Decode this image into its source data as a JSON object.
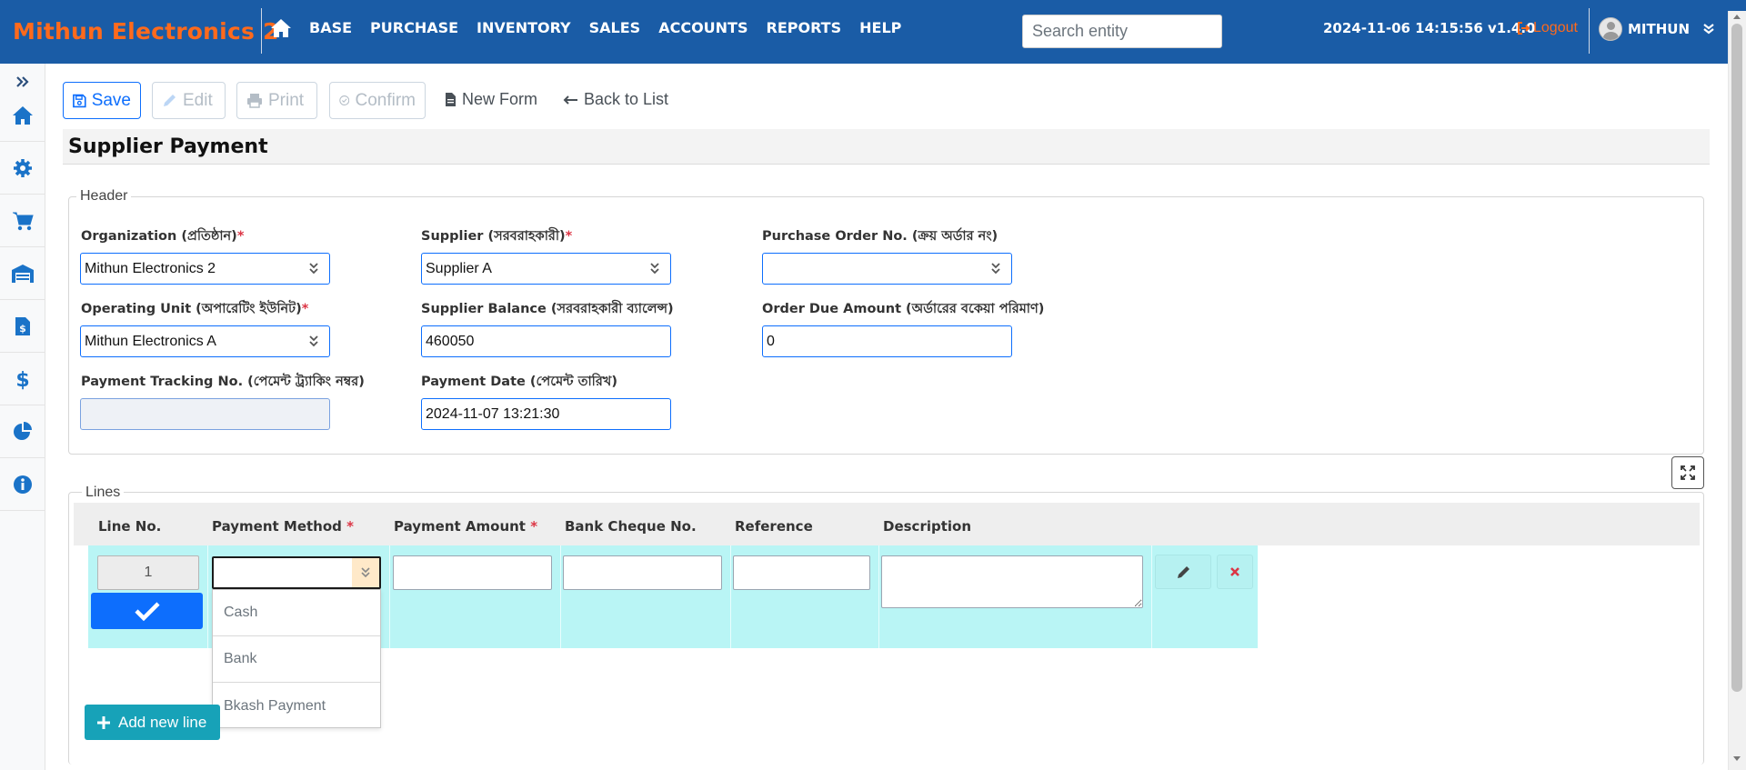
{
  "app": {
    "brand": "Mithun Electronics 2",
    "datetime_version": "2024-11-06 14:15:56 v1.4.0",
    "logout": "Logout",
    "user": "MITHUN"
  },
  "nav": {
    "items": [
      "BASE",
      "PURCHASE",
      "INVENTORY",
      "SALES",
      "ACCOUNTS",
      "REPORTS",
      "HELP"
    ],
    "search_placeholder": "Search entity"
  },
  "sidebar": {
    "icons": [
      "expand-icon",
      "home-icon",
      "gear-icon",
      "cart-icon",
      "warehouse-icon",
      "invoice-icon",
      "dollar-icon",
      "pie-chart-icon",
      "info-icon"
    ]
  },
  "toolbar": {
    "save": "Save",
    "edit": "Edit",
    "print": "Print",
    "confirm": "Confirm",
    "new_form": "New Form",
    "back_to_list": "Back to List"
  },
  "page": {
    "title": "Supplier Payment"
  },
  "header": {
    "legend": "Header",
    "organization": {
      "label": "Organization (প্রতিষ্ঠান)",
      "required": "*",
      "value": "Mithun Electronics 2"
    },
    "supplier": {
      "label": "Supplier (সরবরাহকারী)",
      "required": "*",
      "value": "Supplier A"
    },
    "purchase_order": {
      "label": "Purchase Order No. (ক্রয় অর্ডার নং)",
      "value": ""
    },
    "operating_unit": {
      "label": "Operating Unit (অপারেটিং ইউনিট)",
      "required": "*",
      "value": "Mithun Electronics A"
    },
    "supplier_balance": {
      "label": "Supplier Balance (সরবরাহকারী ব্যালেন্স)",
      "value": "460050"
    },
    "order_due_amount": {
      "label": "Order Due Amount (অর্ডারের বকেয়া পরিমাণ)",
      "value": "0"
    },
    "payment_tracking": {
      "label": "Payment Tracking No. (পেমেন্ট ট্র্যাকিং নম্বর)",
      "value": ""
    },
    "payment_date": {
      "label": "Payment Date (পেমেন্ট তারিখ)",
      "value": "2024-11-07 13:21:30"
    }
  },
  "lines": {
    "legend": "Lines",
    "columns": {
      "line_no": "Line No.",
      "payment_method": "Payment Method",
      "payment_amount": "Payment Amount",
      "bank_cheque": "Bank Cheque No.",
      "reference": "Reference",
      "description": "Description",
      "required": "*"
    },
    "row": {
      "line_no": "1"
    },
    "payment_method_options": [
      "Cash",
      "Bank",
      "Bkash Payment"
    ],
    "add_line": "Add new line"
  },
  "colors": {
    "navbar": "#1a5ca6",
    "brand": "#ff6a1c",
    "primary": "#0d6efd",
    "row_bg": "#b9f5f5",
    "add_line": "#17a2b8"
  }
}
